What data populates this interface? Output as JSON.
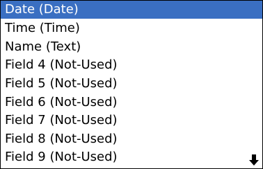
{
  "list": {
    "items": [
      {
        "label": "Date (Date)",
        "selected": true
      },
      {
        "label": "Time (Time)",
        "selected": false
      },
      {
        "label": "Name (Text)",
        "selected": false
      },
      {
        "label": "Field 4 (Not-Used)",
        "selected": false
      },
      {
        "label": "Field 5 (Not-Used)",
        "selected": false
      },
      {
        "label": "Field 6 (Not-Used)",
        "selected": false
      },
      {
        "label": "Field 7 (Not-Used)",
        "selected": false
      },
      {
        "label": "Field 8 (Not-Used)",
        "selected": false
      },
      {
        "label": "Field 9 (Not-Used)",
        "selected": false
      }
    ],
    "scroll_icon": "arrow-down-icon"
  },
  "colors": {
    "selection": "#3a6fc2",
    "text": "#000000",
    "selected_text": "#ffffff",
    "background": "#ffffff"
  }
}
